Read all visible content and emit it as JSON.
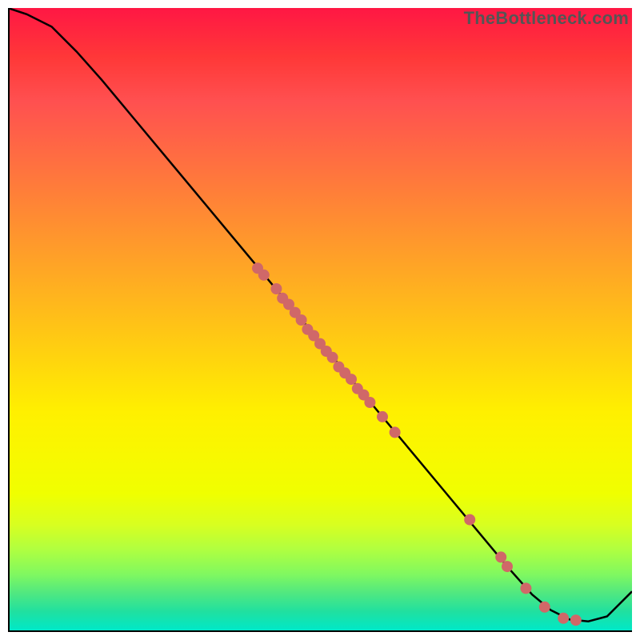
{
  "watermark": "TheBottleneck.com",
  "chart_data": {
    "type": "line",
    "title": "",
    "xlabel": "",
    "ylabel": "",
    "xlim": [
      0,
      100
    ],
    "ylim": [
      0,
      100
    ],
    "background": "rainbow-gradient-red-to-green",
    "series": [
      {
        "name": "main-curve",
        "x": [
          0,
          3,
          7,
          11,
          15,
          20,
          25,
          30,
          35,
          40,
          45,
          50,
          55,
          60,
          65,
          70,
          75,
          80,
          84,
          87,
          90,
          93,
          96,
          100
        ],
        "y": [
          100,
          99,
          97,
          93,
          88.5,
          82.5,
          76.5,
          70.5,
          64.5,
          58.5,
          52.5,
          46.5,
          40.5,
          34.5,
          28.5,
          22.5,
          16.5,
          10.5,
          6,
          3.5,
          2,
          1.7,
          2.5,
          6.5
        ]
      }
    ],
    "highlight_points": [
      {
        "x": 40,
        "y": 58.3
      },
      {
        "x": 41,
        "y": 57.2
      },
      {
        "x": 43,
        "y": 55.0
      },
      {
        "x": 44,
        "y": 53.5
      },
      {
        "x": 45,
        "y": 52.5
      },
      {
        "x": 46,
        "y": 51.2
      },
      {
        "x": 47,
        "y": 50.0
      },
      {
        "x": 48,
        "y": 48.5
      },
      {
        "x": 49,
        "y": 47.5
      },
      {
        "x": 50,
        "y": 46.2
      },
      {
        "x": 51,
        "y": 45.0
      },
      {
        "x": 52,
        "y": 44.0
      },
      {
        "x": 53,
        "y": 42.5
      },
      {
        "x": 54,
        "y": 41.5
      },
      {
        "x": 55,
        "y": 40.5
      },
      {
        "x": 56,
        "y": 39.0
      },
      {
        "x": 57,
        "y": 38.0
      },
      {
        "x": 58,
        "y": 36.8
      },
      {
        "x": 60,
        "y": 34.5
      },
      {
        "x": 62,
        "y": 32.0
      },
      {
        "x": 74,
        "y": 18.0
      },
      {
        "x": 79,
        "y": 12.0
      },
      {
        "x": 80,
        "y": 10.5
      },
      {
        "x": 83,
        "y": 7.0
      },
      {
        "x": 86,
        "y": 4.0
      },
      {
        "x": 89,
        "y": 2.2
      },
      {
        "x": 91,
        "y": 1.9
      }
    ],
    "marker_color": "#d06868",
    "line_color": "#000000"
  }
}
